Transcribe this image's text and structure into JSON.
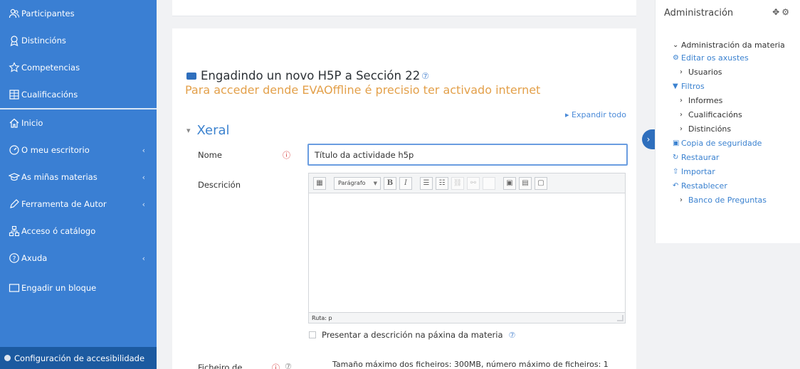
{
  "sidebar": {
    "items": [
      {
        "label": "Participantes",
        "icon": "participants-icon"
      },
      {
        "label": "Distincións",
        "icon": "badges-icon"
      },
      {
        "label": "Competencias",
        "icon": "competencies-icon"
      },
      {
        "label": "Cualificacións",
        "icon": "grades-icon"
      },
      {
        "label": "Inicio",
        "icon": "home-icon"
      },
      {
        "label": "O meu escritorio",
        "icon": "dashboard-icon"
      },
      {
        "label": "As miñas materias",
        "icon": "courses-icon"
      },
      {
        "label": "Ferramenta de Autor",
        "icon": "pen-icon"
      },
      {
        "label": "Acceso ó catálogo",
        "icon": "catalog-icon"
      },
      {
        "label": "Axuda",
        "icon": "help-icon"
      },
      {
        "label": "Engadir un bloque",
        "icon": "block-icon"
      }
    ],
    "chevron": "‹",
    "accessibility": "Configuración de accesibilidade"
  },
  "main": {
    "title": "Engadindo un novo H5P a Sección 22",
    "warning": "Para acceder dende EVAOffline é precisio ter activado internet",
    "expand_all": "Expandir todo",
    "section": "Xeral",
    "name_label": "Nome",
    "name_value": "Título da actividade h5p",
    "description_label": "Descrición",
    "editor": {
      "format": "Parágrafo",
      "path": "Ruta: p"
    },
    "show_description": "Presentar a descrición na páxina da materia",
    "file_label": "Ficheiro de",
    "file_limits": "Tamaño máximo dos ficheiros: 300MB, número máximo de ficheiros: 1"
  },
  "admin": {
    "title": "Administración",
    "items": [
      {
        "label": "Administración da materia",
        "style": "expanded"
      },
      {
        "label": "Editar os axustes",
        "style": "link",
        "icon": "gear-icon"
      },
      {
        "label": "Usuarios",
        "style": "collapsed"
      },
      {
        "label": "Filtros",
        "style": "link",
        "icon": "filter-icon"
      },
      {
        "label": "Informes",
        "style": "collapsed"
      },
      {
        "label": "Cualificacións",
        "style": "collapsed"
      },
      {
        "label": "Distincións",
        "style": "collapsed"
      },
      {
        "label": "Copia de seguridade",
        "style": "link",
        "icon": "backup-icon"
      },
      {
        "label": "Restaurar",
        "style": "link",
        "icon": "restore-icon"
      },
      {
        "label": "Importar",
        "style": "link",
        "icon": "import-icon"
      },
      {
        "label": "Restablecer",
        "style": "link",
        "icon": "reset-icon"
      },
      {
        "label": "Banco de Preguntas",
        "style": "collapsed-blue"
      }
    ]
  },
  "colors": {
    "sidebar": "#3a7fd3",
    "link": "#3b82d0",
    "warning": "#e3a04a",
    "required": "#d32f2f"
  }
}
